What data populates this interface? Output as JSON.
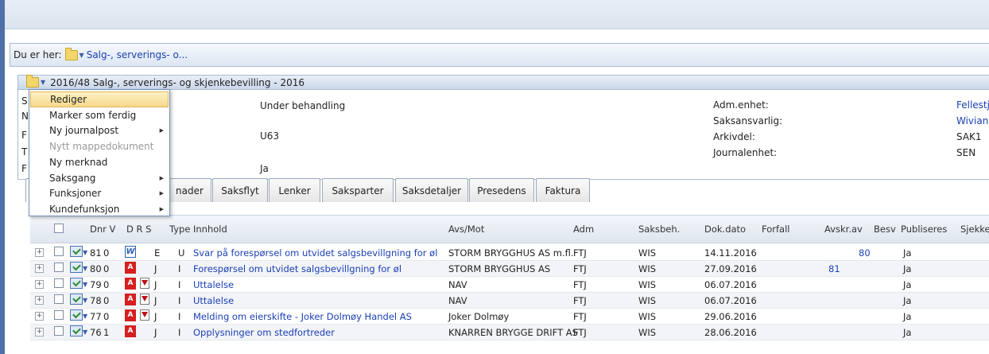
{
  "breadcrumb": {
    "label": "Du er her:",
    "path": "Salg-, serverings- o..."
  },
  "case": {
    "title": "2016/48  Salg-, serverings- og skjenkebevilling - 2016",
    "status": "Under behandling",
    "code": "U63",
    "flag": "Ja",
    "labels": [
      "Adm.enhet:",
      "Saksansvarlig:",
      "Arkivdel:",
      "Journalenhet:"
    ],
    "values": [
      "Fellestj",
      "Wiviann",
      "SAK1",
      "SEN"
    ],
    "left_initials": [
      "S",
      "N",
      "F",
      "T",
      "F"
    ]
  },
  "context_menu": [
    {
      "label": "Rediger",
      "highlighted": true,
      "disabled": false,
      "submenu": false
    },
    {
      "label": "Marker som ferdig",
      "highlighted": false,
      "disabled": false,
      "submenu": false
    },
    {
      "label": "Ny journalpost",
      "highlighted": false,
      "disabled": false,
      "submenu": true
    },
    {
      "label": "Nytt mappedokument",
      "highlighted": false,
      "disabled": true,
      "submenu": false
    },
    {
      "label": "Ny merknad",
      "highlighted": false,
      "disabled": false,
      "submenu": false
    },
    {
      "label": "Saksgang",
      "highlighted": false,
      "disabled": false,
      "submenu": true
    },
    {
      "label": "Funksjoner",
      "highlighted": false,
      "disabled": false,
      "submenu": true
    },
    {
      "label": "Kundefunksjon",
      "highlighted": false,
      "disabled": false,
      "submenu": true
    }
  ],
  "tabs": [
    "",
    "nader",
    "Saksflyt",
    "Lenker",
    "Saksparter",
    "Saksdetaljer",
    "Presedens",
    "Faktura"
  ],
  "grid": {
    "headers": {
      "dnr": "Dnr V",
      "drs": "D R S",
      "type": "Type",
      "innhold": "Innhold",
      "avsmot": "Avs/Mot",
      "adm": "Adm",
      "saksbeh": "Saksbeh.",
      "dokdato": "Dok.dato",
      "forfall": "Forfall",
      "avskrav": "Avskr.av",
      "besv": "Besv",
      "publiseres": "Publiseres",
      "sjekke": "Sjekke"
    },
    "rows": [
      {
        "dnr": "81",
        "v": "0",
        "doc": "word",
        "flag": false,
        "s": "E",
        "type": "U",
        "innhold": "Svar på forespørsel om utvidet salgsbevillgning for øl",
        "avsmot": "STORM BRYGGHUS AS m.fl.",
        "adm": "FTJ",
        "saksbeh": "WIS",
        "dokdato": "14.11.2016",
        "forfall": "",
        "avskrav": "",
        "besv": "80",
        "publiseres": "Ja"
      },
      {
        "dnr": "80",
        "v": "0",
        "doc": "pdf",
        "flag": false,
        "s": "J",
        "type": "I",
        "innhold": "Forespørsel om utvidet salgsbevillgning for øl",
        "avsmot": "STORM BRYGGHUS AS",
        "adm": "FTJ",
        "saksbeh": "WIS",
        "dokdato": "27.09.2016",
        "forfall": "",
        "avskrav": "81",
        "besv": "",
        "publiseres": "Ja"
      },
      {
        "dnr": "79",
        "v": "0",
        "doc": "pdf",
        "flag": true,
        "s": "J",
        "type": "I",
        "innhold": "Uttalelse",
        "avsmot": "NAV",
        "adm": "FTJ",
        "saksbeh": "WIS",
        "dokdato": "06.07.2016",
        "forfall": "",
        "avskrav": "",
        "besv": "",
        "publiseres": "Ja"
      },
      {
        "dnr": "78",
        "v": "0",
        "doc": "pdf",
        "flag": true,
        "s": "J",
        "type": "I",
        "innhold": "Uttalelse",
        "avsmot": "NAV",
        "adm": "FTJ",
        "saksbeh": "WIS",
        "dokdato": "06.07.2016",
        "forfall": "",
        "avskrav": "",
        "besv": "",
        "publiseres": "Ja"
      },
      {
        "dnr": "77",
        "v": "0",
        "doc": "pdf",
        "flag": true,
        "s": "J",
        "type": "I",
        "innhold": "Melding om eierskifte - Joker Dolmøy Handel AS",
        "avsmot": "Joker Dolmøy",
        "adm": "FTJ",
        "saksbeh": "WIS",
        "dokdato": "29.06.2016",
        "forfall": "",
        "avskrav": "",
        "besv": "",
        "publiseres": "Ja"
      },
      {
        "dnr": "76",
        "v": "1",
        "doc": "pdf",
        "flag": false,
        "s": "J",
        "type": "I",
        "innhold": "Opplysninger om stedfortreder",
        "avsmot": "KNARREN BRYGGE DRIFT AS",
        "adm": "FTJ",
        "saksbeh": "WIS",
        "dokdato": "28.06.2016",
        "forfall": "",
        "avskrav": "",
        "besv": "",
        "publiseres": "Ja"
      }
    ]
  }
}
